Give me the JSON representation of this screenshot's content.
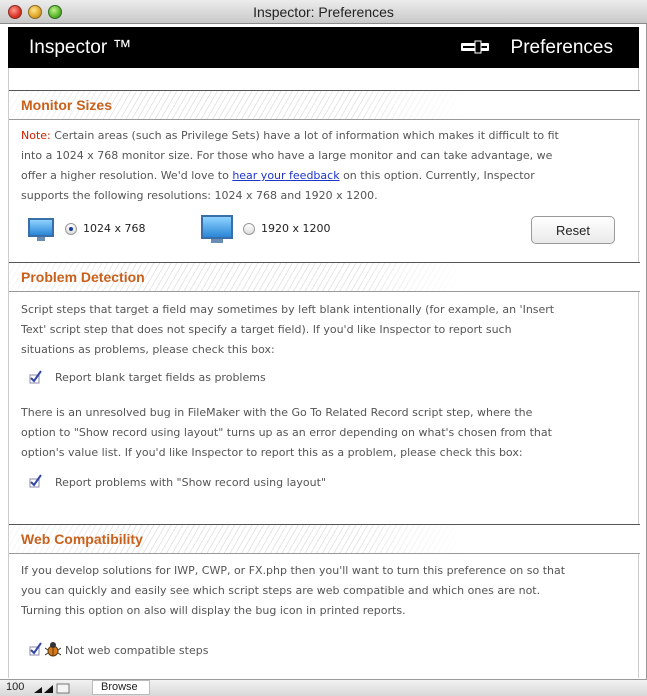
{
  "window": {
    "title": "Inspector: Preferences"
  },
  "header": {
    "app_title": "Inspector ™",
    "preferences_label": "Preferences"
  },
  "monitor_sizes": {
    "title": "Monitor Sizes",
    "note_label": "Note:",
    "line1_rest": " Certain areas (such as Privilege Sets) have a lot of information which makes it difficult to fit",
    "line2": "into a 1024 x 768 monitor size. For those who have a large monitor and can take advantage, we",
    "line3_before": "offer a higher resolution. We'd love to ",
    "feedback_link": "hear your feedback",
    "line3_after": " on this option. Currently, Inspector",
    "line4": "supports the following resolutions: 1024 x 768 and 1920 x 1200.",
    "options": [
      {
        "label": "1024 x 768",
        "selected": true
      },
      {
        "label": "1920 x 1200",
        "selected": false
      }
    ],
    "reset_label": "Reset"
  },
  "problem_detection": {
    "title": "Problem Detection",
    "para1_lines": [
      "Script steps that target a field may sometimes by left blank intentionally (for example, an 'Insert",
      "Text' script step that does not specify a target field). If you'd like Inspector to report such",
      "situations as problems, please check this box:"
    ],
    "check1_label": "Report blank target fields as problems",
    "check1_checked": true,
    "para2_lines": [
      "There is an unresolved bug in FileMaker with the Go To Related Record script step, where the",
      "option to \"Show record using layout\" turns up as an error depending on what's chosen from that",
      "option's value list. If you'd like Inspector to report this as a problem, please check this box:"
    ],
    "check2_label": "Report problems with \"Show record using layout\"",
    "check2_checked": true
  },
  "web_compatibility": {
    "title": "Web Compatibility",
    "para_lines": [
      "If you develop solutions for IWP, CWP, or FX.php then you'll want to turn this preference on so that",
      "you can quickly and easily see which script steps are web compatible and which ones are not.",
      "Turning this option on also will display the bug icon in printed reports."
    ],
    "check_label": "Not web compatible steps",
    "check_checked": true
  },
  "statusbar": {
    "zoom": "100",
    "mode": "Browse"
  },
  "colors": {
    "section_title": "#c8611c",
    "note": "#cc2200",
    "link": "#1d34c8",
    "header_bg": "#000000"
  },
  "icons": [
    "close-icon",
    "minimize-icon",
    "zoom-icon",
    "slider-icon",
    "monitor-icon",
    "checkmark-icon",
    "bug-icon"
  ]
}
